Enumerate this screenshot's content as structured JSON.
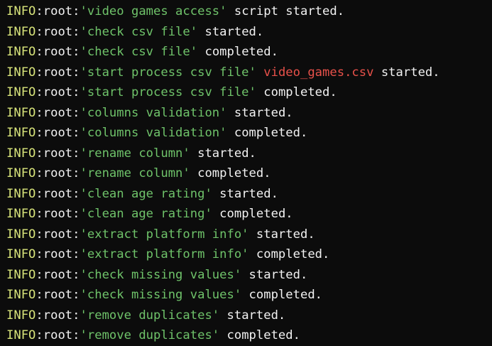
{
  "terminal": {
    "colors": {
      "background": "#0c0c0c",
      "level": "#d7e37a",
      "quoted": "#6fc36a",
      "file": "#e8514a",
      "text": "#f2f2f2"
    },
    "lines": [
      {
        "level": "INFO",
        "logger": "root",
        "message": "'video games access'",
        "file": "",
        "status": "script started."
      },
      {
        "level": "INFO",
        "logger": "root",
        "message": "'check csv file'",
        "file": "",
        "status": "started."
      },
      {
        "level": "INFO",
        "logger": "root",
        "message": "'check csv file'",
        "file": "",
        "status": "completed."
      },
      {
        "level": "INFO",
        "logger": "root",
        "message": "'start process csv file'",
        "file": "video_games.csv",
        "status": "started."
      },
      {
        "level": "INFO",
        "logger": "root",
        "message": "'start process csv file'",
        "file": "",
        "status": "completed."
      },
      {
        "level": "INFO",
        "logger": "root",
        "message": "'columns validation'",
        "file": "",
        "status": "started."
      },
      {
        "level": "INFO",
        "logger": "root",
        "message": "'columns validation'",
        "file": "",
        "status": "completed."
      },
      {
        "level": "INFO",
        "logger": "root",
        "message": "'rename column'",
        "file": "",
        "status": "started."
      },
      {
        "level": "INFO",
        "logger": "root",
        "message": "'rename column'",
        "file": "",
        "status": "completed."
      },
      {
        "level": "INFO",
        "logger": "root",
        "message": "'clean age rating'",
        "file": "",
        "status": "started."
      },
      {
        "level": "INFO",
        "logger": "root",
        "message": "'clean age rating'",
        "file": "",
        "status": "completed."
      },
      {
        "level": "INFO",
        "logger": "root",
        "message": "'extract platform info'",
        "file": "",
        "status": "started."
      },
      {
        "level": "INFO",
        "logger": "root",
        "message": "'extract platform info'",
        "file": "",
        "status": "completed."
      },
      {
        "level": "INFO",
        "logger": "root",
        "message": "'check missing values'",
        "file": "",
        "status": "started."
      },
      {
        "level": "INFO",
        "logger": "root",
        "message": "'check missing values'",
        "file": "",
        "status": "completed."
      },
      {
        "level": "INFO",
        "logger": "root",
        "message": "'remove duplicates'",
        "file": "",
        "status": "started."
      },
      {
        "level": "INFO",
        "logger": "root",
        "message": "'remove duplicates'",
        "file": "",
        "status": "completed."
      }
    ]
  }
}
